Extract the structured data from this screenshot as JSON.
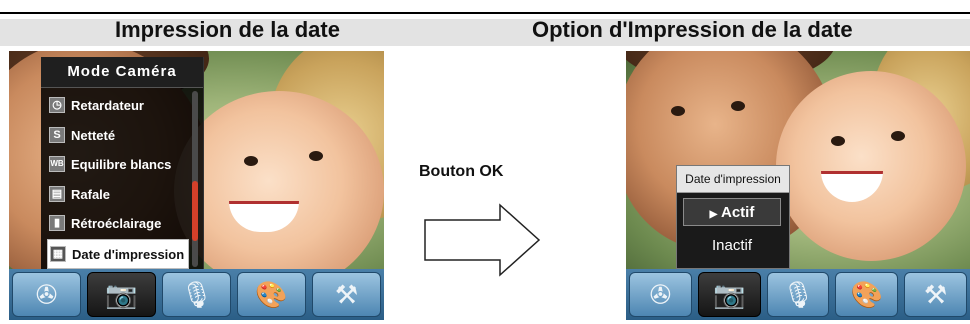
{
  "headers": {
    "left": "Impression de la date",
    "right": "Option d'Impression de la date"
  },
  "left_screen": {
    "menu_title": "Mode Caméra",
    "menu_items": [
      {
        "label": "Retardateur",
        "icon": "timer-icon",
        "glyph": "◷"
      },
      {
        "label": "Netteté",
        "icon": "sharpness-icon",
        "glyph": "S"
      },
      {
        "label": "Equilibre blancs",
        "icon": "white-balance-icon",
        "glyph": "WB"
      },
      {
        "label": "Rafale",
        "icon": "burst-icon",
        "glyph": "▤"
      },
      {
        "label": "Rétroéclairage",
        "icon": "backlight-icon",
        "glyph": "▮"
      },
      {
        "label": "Date d'impression",
        "icon": "date-stamp-icon",
        "glyph": "▦"
      }
    ],
    "selected_index": 5
  },
  "toolbar": [
    {
      "icon": "film-reel-icon",
      "glyph": "✇"
    },
    {
      "icon": "camera-icon",
      "glyph": "📷"
    },
    {
      "icon": "microphone-icon",
      "glyph": "🎙"
    },
    {
      "icon": "palette-icon",
      "glyph": "🎨"
    },
    {
      "icon": "tools-icon",
      "glyph": "⚒"
    }
  ],
  "toolbar_selected_index": 1,
  "middle": {
    "button_label": "Bouton OK"
  },
  "right_screen": {
    "popup_title": "Date d'impression",
    "options": [
      "Actif",
      "Inactif"
    ],
    "selected_option_index": 0,
    "selected_marker": "▶"
  },
  "colors": {
    "highlight_scrollbar": "#d4402a",
    "toolbar_blue": "#4a7fa8"
  }
}
